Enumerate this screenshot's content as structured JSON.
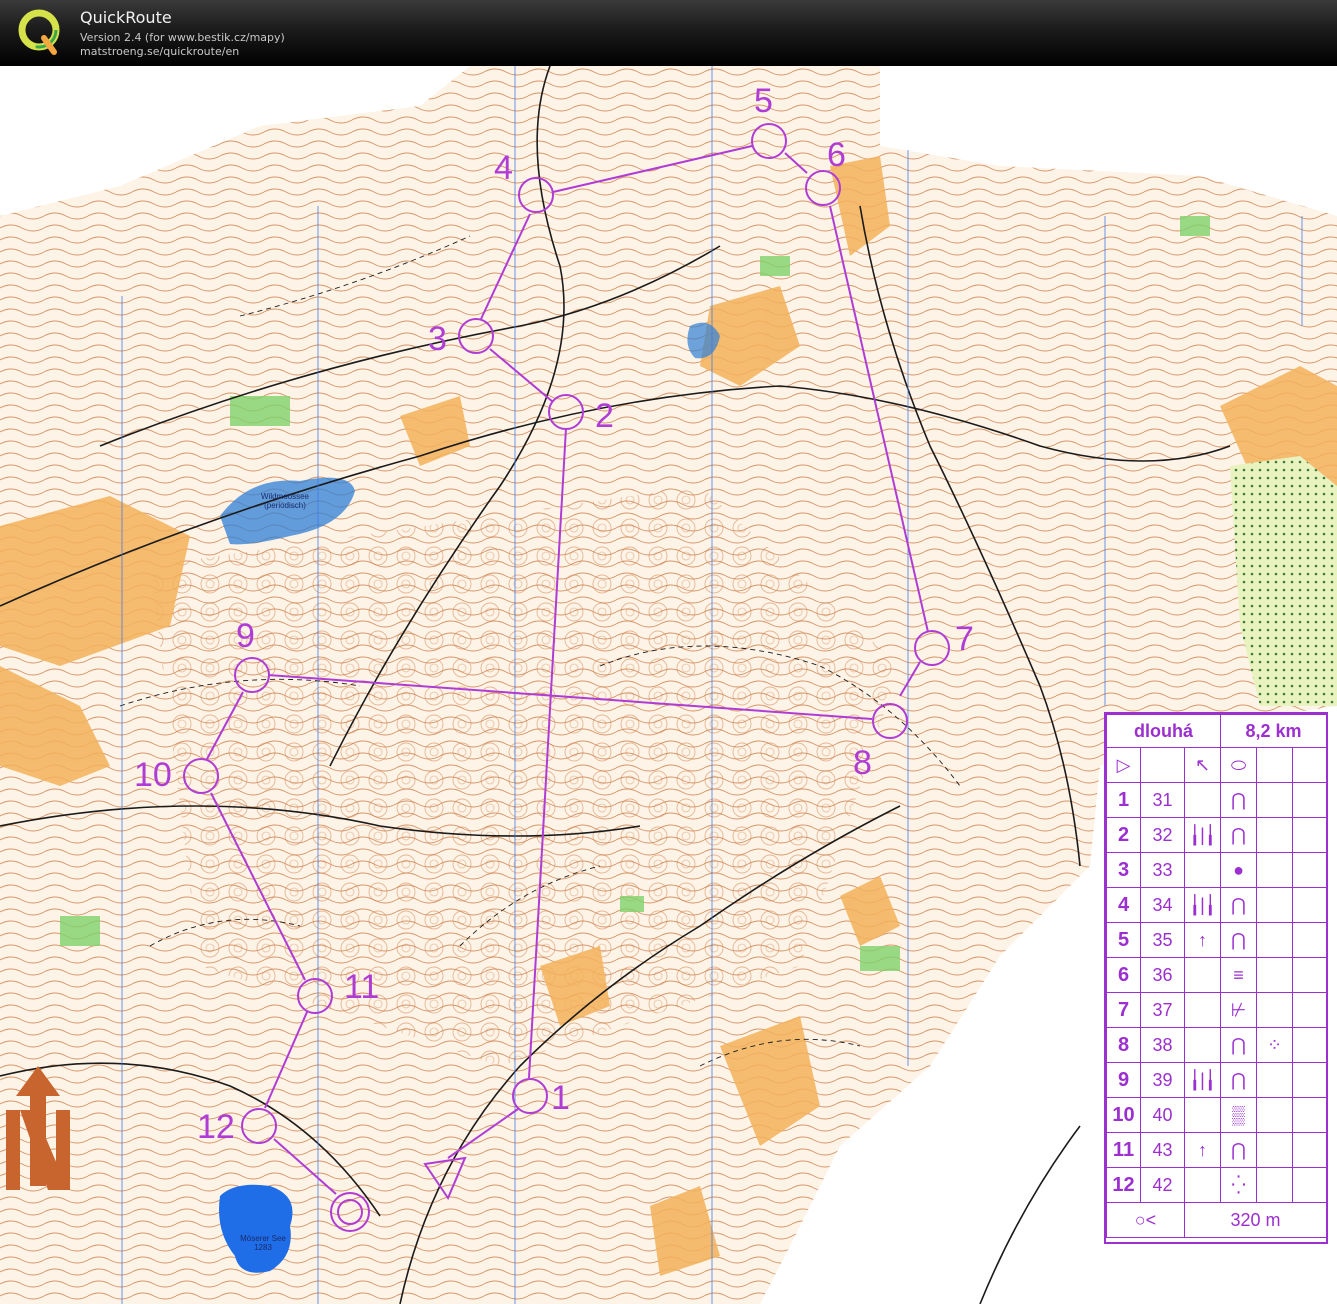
{
  "app": {
    "title": "QuickRoute",
    "version_line": "Version 2.4  (for www.bestik.cz/mapy)",
    "url_line": "matstroeng.se/quickroute/en",
    "logo_letter": "Q"
  },
  "map": {
    "type": "orienteering-map",
    "colors": {
      "course": "#b03cd6",
      "open_land": "#f3b25a",
      "contour": "#c9733a",
      "water": "#2f7fd6",
      "meridian": "#3b78e7",
      "vegetation": "#7fd26a"
    },
    "place_names": [
      {
        "name": "wildmoossee",
        "line1": "Wildmoossee",
        "line2": "(periodisch)"
      },
      {
        "name": "moeserer-see",
        "line1": "Möserer See",
        "line2": "1283"
      }
    ],
    "course": {
      "start_symbol": "triangle",
      "finish_symbol": "double-circle",
      "controls": [
        {
          "label": "1"
        },
        {
          "label": "2"
        },
        {
          "label": "3"
        },
        {
          "label": "4"
        },
        {
          "label": "5"
        },
        {
          "label": "6"
        },
        {
          "label": "7"
        },
        {
          "label": "8"
        },
        {
          "label": "9"
        },
        {
          "label": "10"
        },
        {
          "label": "11"
        },
        {
          "label": "12"
        }
      ]
    }
  },
  "description_sheet": {
    "course_name": "dlouhá",
    "length": "8,2 km",
    "start_row": {
      "sym1": "▷",
      "sym2": "↖",
      "sym3": "⬭"
    },
    "rows": [
      {
        "num": "1",
        "code": "31",
        "feature": "⋂",
        "detail": "",
        "where": ""
      },
      {
        "num": "2",
        "code": "32",
        "feature": "⋂",
        "detail": "╽|╽",
        "where": ""
      },
      {
        "num": "3",
        "code": "33",
        "feature": "●",
        "detail": "",
        "where": ""
      },
      {
        "num": "4",
        "code": "34",
        "feature": "⋂",
        "detail": "╽|╽",
        "where": ""
      },
      {
        "num": "5",
        "code": "35",
        "feature": "⋂",
        "detail": "↑",
        "where": ""
      },
      {
        "num": "6",
        "code": "36",
        "feature": "≡",
        "detail": "",
        "where": ""
      },
      {
        "num": "7",
        "code": "37",
        "feature": "⊬",
        "detail": "",
        "where": ""
      },
      {
        "num": "8",
        "code": "38",
        "feature": "⋂",
        "detail": "",
        "where": "⁘"
      },
      {
        "num": "9",
        "code": "39",
        "feature": "⋂",
        "detail": "╽|╽",
        "where": ""
      },
      {
        "num": "10",
        "code": "40",
        "feature": "▒",
        "detail": "",
        "where": ""
      },
      {
        "num": "11",
        "code": "43",
        "feature": "⋂",
        "detail": "↑",
        "where": ""
      },
      {
        "num": "12",
        "code": "42",
        "feature": "⁛",
        "detail": "",
        "where": ""
      }
    ],
    "finish_row": {
      "symbol": "○<",
      "distance": "320 m"
    }
  },
  "north_arrow": {
    "symbol": "N-arrow"
  }
}
